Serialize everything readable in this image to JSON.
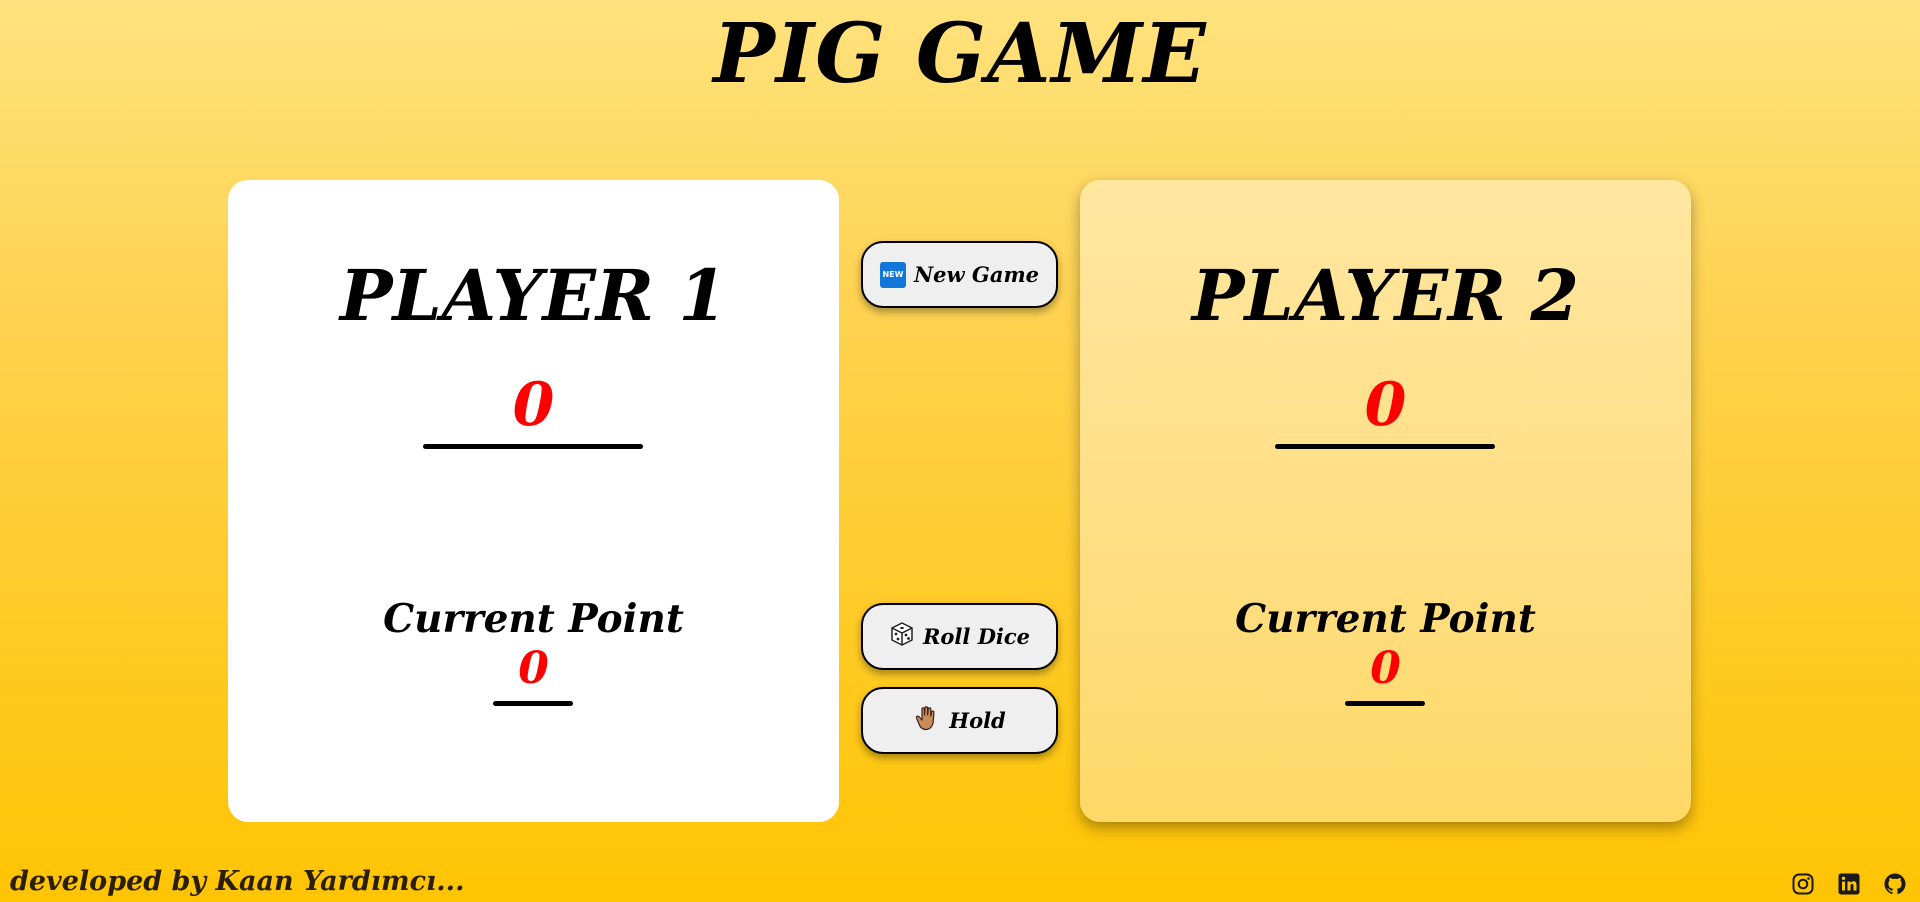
{
  "app": {
    "title": "PIG GAME"
  },
  "players": [
    {
      "name": "PLAYER 1",
      "score": "0",
      "current_label": "Current Point",
      "current": "0"
    },
    {
      "name": "PLAYER 2",
      "score": "0",
      "current_label": "Current Point",
      "current": "0"
    }
  ],
  "controls": {
    "new_game": {
      "label": "New Game",
      "icon": "new-badge-icon",
      "icon_text": "NEW"
    },
    "roll_dice": {
      "label": "Roll Dice",
      "icon": "dice-icon"
    },
    "hold": {
      "label": "Hold",
      "icon": "hand-icon"
    }
  },
  "footer": {
    "credit": "developed by Kaan Yardımcı...",
    "social": [
      "instagram-icon",
      "linkedin-icon",
      "github-icon"
    ]
  },
  "colors": {
    "background_top": "#ffe27e",
    "background_bottom": "#ffc402",
    "active_card": "#ffffff",
    "inactive_card": "#ffe7a0",
    "score": "#ff0000",
    "button": "#efefef"
  }
}
